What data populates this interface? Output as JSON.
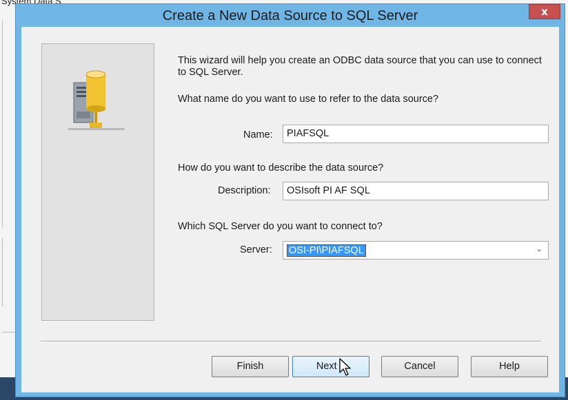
{
  "background": {
    "title_fragment": "System Data S"
  },
  "dialog": {
    "title": "Create a New Data Source to SQL Server",
    "close_glyph": "x"
  },
  "intro": {
    "text": "This wizard will help you create an ODBC data source that you can use to connect to SQL Server."
  },
  "form": {
    "name_question": "What name do you want to use to refer to the data source?",
    "name_label": "Name:",
    "name_value": "PIAFSQL",
    "description_question": "How do you want to describe the data source?",
    "description_label": "Description:",
    "description_value": "OSIsoft PI AF SQL",
    "server_question": "Which SQL Server do you want to connect to?",
    "server_label": "Server:",
    "server_value": "OSI-PI\\PIAFSQL"
  },
  "buttons": {
    "finish": "Finish",
    "next": "Next >",
    "cancel": "Cancel",
    "help": "Help"
  },
  "icons": {
    "database": "database-server-icon",
    "close": "close-icon",
    "dropdown": "chevron-down-icon",
    "cursor": "mouse-pointer-icon"
  },
  "colors": {
    "title_bar": "#6fb6e6",
    "close_button": "#c75050",
    "selection": "#3399ff"
  }
}
